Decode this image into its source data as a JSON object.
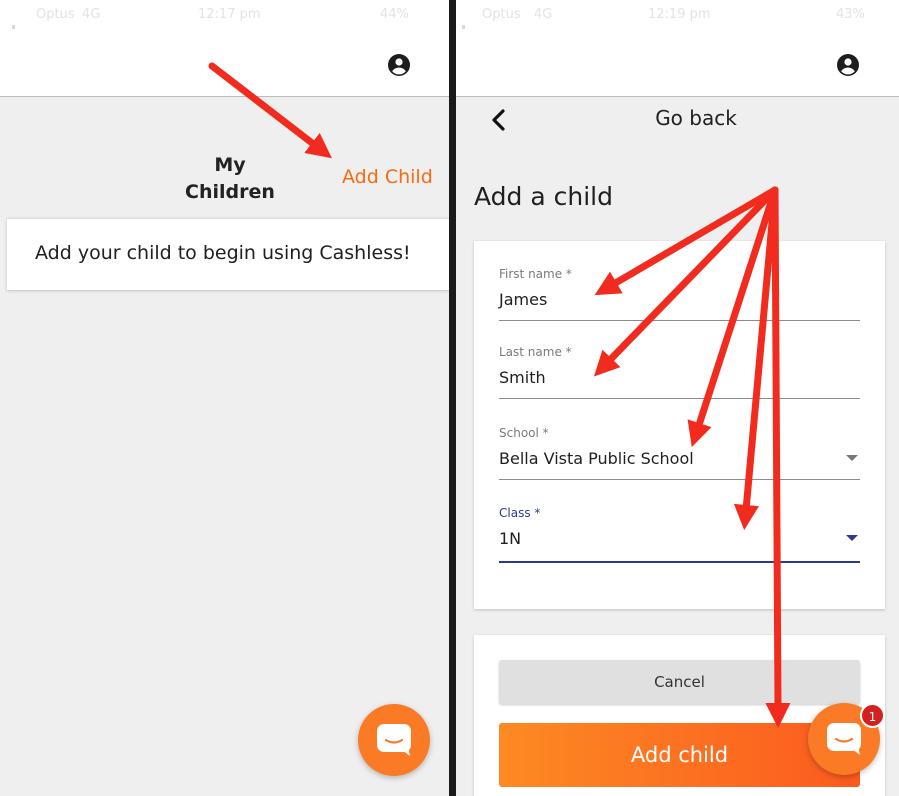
{
  "left": {
    "status": {
      "carrier": "Optus",
      "network": "4G",
      "time": "12:17 pm",
      "battery": "44%"
    },
    "header": {
      "account_icon": "account-circle-icon"
    },
    "title": "My Children",
    "add_child_label": "Add Child",
    "empty_message": "Add your child to begin using Cashless!",
    "chat_icon": "chat-bubble-icon"
  },
  "right": {
    "status": {
      "carrier": "Optus",
      "network": "4G",
      "time": "12:19 pm",
      "battery": "43%"
    },
    "header": {
      "account_icon": "account-circle-icon"
    },
    "back_label": "Go back",
    "page_title": "Add a child",
    "form": {
      "first_name": {
        "label": "First name *",
        "value": "James"
      },
      "last_name": {
        "label": "Last name *",
        "value": "Smith"
      },
      "school": {
        "label": "School *",
        "value": "Bella Vista Public School"
      },
      "class": {
        "label": "Class *",
        "value": "1N"
      }
    },
    "cancel_label": "Cancel",
    "submit_label": "Add child",
    "chat_badge": "1"
  },
  "colors": {
    "accent": "#fa6a10",
    "focus": "#2b3896",
    "annotation_arrow": "#f22b1f"
  }
}
